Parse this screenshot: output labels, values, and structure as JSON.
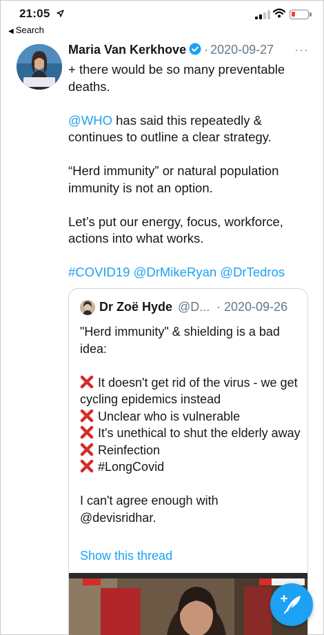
{
  "status_bar": {
    "time": "21:05",
    "back_label": "Search"
  },
  "tweet": {
    "author_name": "Maria Van Kerkhove",
    "date": "2020-09-27",
    "more_label": "···",
    "paragraphs": [
      {
        "text": "+ there would be so many preventable deaths."
      },
      {
        "mention": "@WHO",
        "text": " has said this repeatedly & continues to outline a clear strategy."
      },
      {
        "text": "“Herd immunity” or natural population immunity is not an option."
      },
      {
        "text": "Let’s put our energy, focus, workforce, actions into what works."
      },
      {
        "hashtags": "#COVID19 @DrMikeRyan @DrTedros"
      }
    ]
  },
  "quoted_tweet": {
    "author_name": "Dr Zoë Hyde",
    "handle": "@D...",
    "date": "2020-09-26",
    "intro": "\"Herd immunity\" & shielding is a bad idea:",
    "points": [
      "It doesn't get rid of the virus - we get cycling epidemics instead",
      "Unclear who is vulnerable",
      "It's unethical to shut the elderly away",
      "Reinfection",
      "#LongCovid"
    ],
    "closing_line_1": "I can't agree enough with",
    "closing_line_2": "@devisridhar.",
    "show_thread": "Show this thread"
  },
  "colors": {
    "link": "#1da1f2",
    "muted": "#657786",
    "cross": "#d62b2b"
  },
  "icons": {
    "verified": "verified-badge-icon",
    "location": "location-arrow-icon",
    "compose": "compose-feather-icon"
  }
}
